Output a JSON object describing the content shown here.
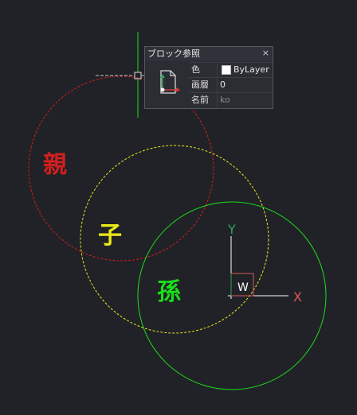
{
  "canvas": {
    "labels": {
      "parent": "親",
      "child": "子",
      "grandchild": "孫"
    },
    "ucs": {
      "y_label": "Y",
      "x_label": "X",
      "w_label": "W"
    },
    "colors": {
      "background": "#212227",
      "parent": "#d01f1f",
      "child": "#e8e81a",
      "grandchild": "#19e019",
      "ucs_y": "#2ea35b",
      "ucs_x": "#d85a5a"
    }
  },
  "tooltip": {
    "title": "ブロック参照",
    "close_glyph": "×",
    "properties": [
      {
        "key": "色",
        "value": "ByLayer"
      },
      {
        "key": "画層",
        "value": "0"
      },
      {
        "key": "名前",
        "value": "ko"
      }
    ]
  }
}
